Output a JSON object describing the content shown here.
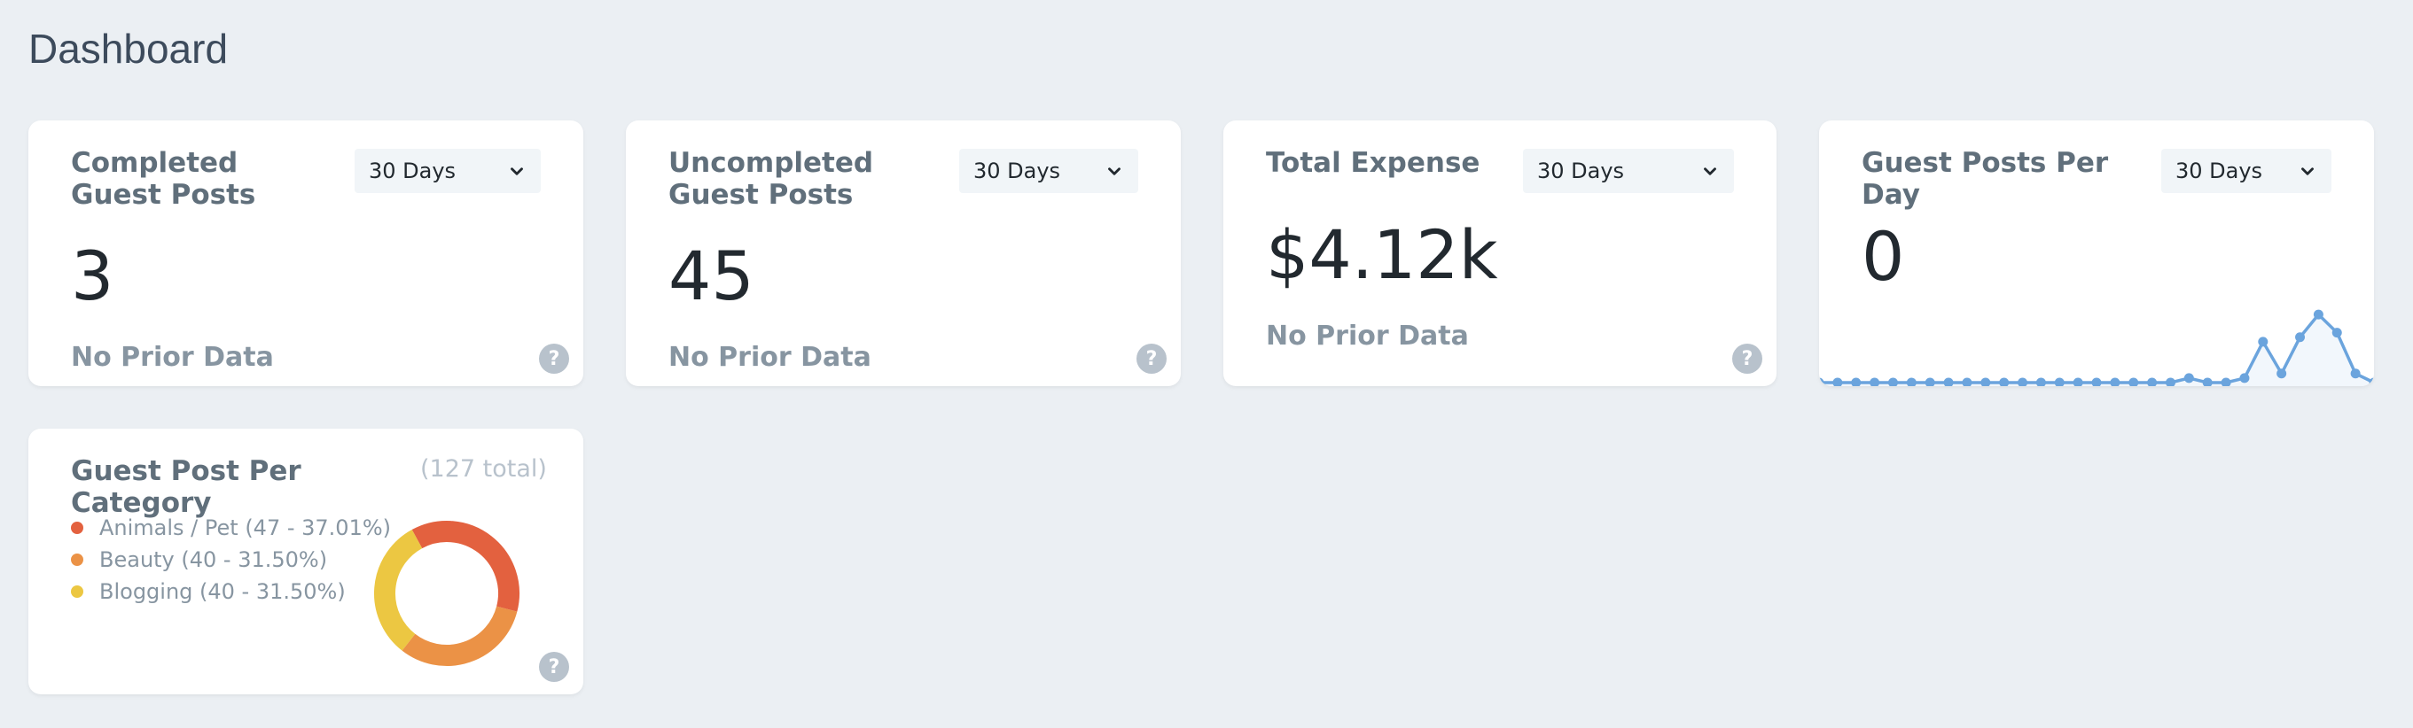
{
  "page": {
    "title": "Dashboard"
  },
  "cards": [
    {
      "title": "Completed Guest Posts",
      "range": "30 Days",
      "value": "3",
      "footer": "No Prior Data"
    },
    {
      "title": "Uncompleted Guest Posts",
      "range": "30 Days",
      "value": "45",
      "footer": "No Prior Data"
    },
    {
      "title": "Total Expense",
      "range": "30 Days",
      "value": "$4.12k",
      "footer": "No Prior Data"
    },
    {
      "title": "Guest Posts Per Day",
      "range": "30 Days",
      "value": "0"
    }
  ],
  "help_glyph": "?",
  "sparkline": {
    "type": "area",
    "values": [
      0,
      0,
      0,
      0,
      0,
      0,
      0,
      0,
      0,
      0,
      0,
      0,
      0,
      0,
      0,
      0,
      0,
      0,
      0,
      0,
      1,
      0,
      0,
      1,
      9,
      2,
      10,
      15,
      11,
      2,
      0
    ],
    "ylim": [
      0,
      16
    ],
    "color": "#6ba4dd",
    "fill": "#f2f7fc"
  },
  "category": {
    "title": "Guest Post Per Category",
    "total": "(127 total)",
    "items": [
      {
        "label": "Animals / Pet (47 - 37.01%)",
        "value": 47,
        "color": "#e3613f"
      },
      {
        "label": "Beauty (40 - 31.50%)",
        "value": 40,
        "color": "#eb9246"
      },
      {
        "label": "Blogging (40 - 31.50%)",
        "value": 40,
        "color": "#ecc742"
      }
    ]
  },
  "chart_data": [
    {
      "type": "line",
      "title": "Guest Posts Per Day",
      "x": [
        1,
        2,
        3,
        4,
        5,
        6,
        7,
        8,
        9,
        10,
        11,
        12,
        13,
        14,
        15,
        16,
        17,
        18,
        19,
        20,
        21,
        22,
        23,
        24,
        25,
        26,
        27,
        28,
        29,
        30,
        31
      ],
      "values": [
        0,
        0,
        0,
        0,
        0,
        0,
        0,
        0,
        0,
        0,
        0,
        0,
        0,
        0,
        0,
        0,
        0,
        0,
        0,
        0,
        1,
        0,
        0,
        1,
        9,
        2,
        10,
        15,
        11,
        2,
        0
      ]
    },
    {
      "type": "pie",
      "title": "Guest Post Per Category",
      "categories": [
        "Animals / Pet",
        "Beauty",
        "Blogging"
      ],
      "values": [
        47,
        40,
        40
      ]
    }
  ]
}
